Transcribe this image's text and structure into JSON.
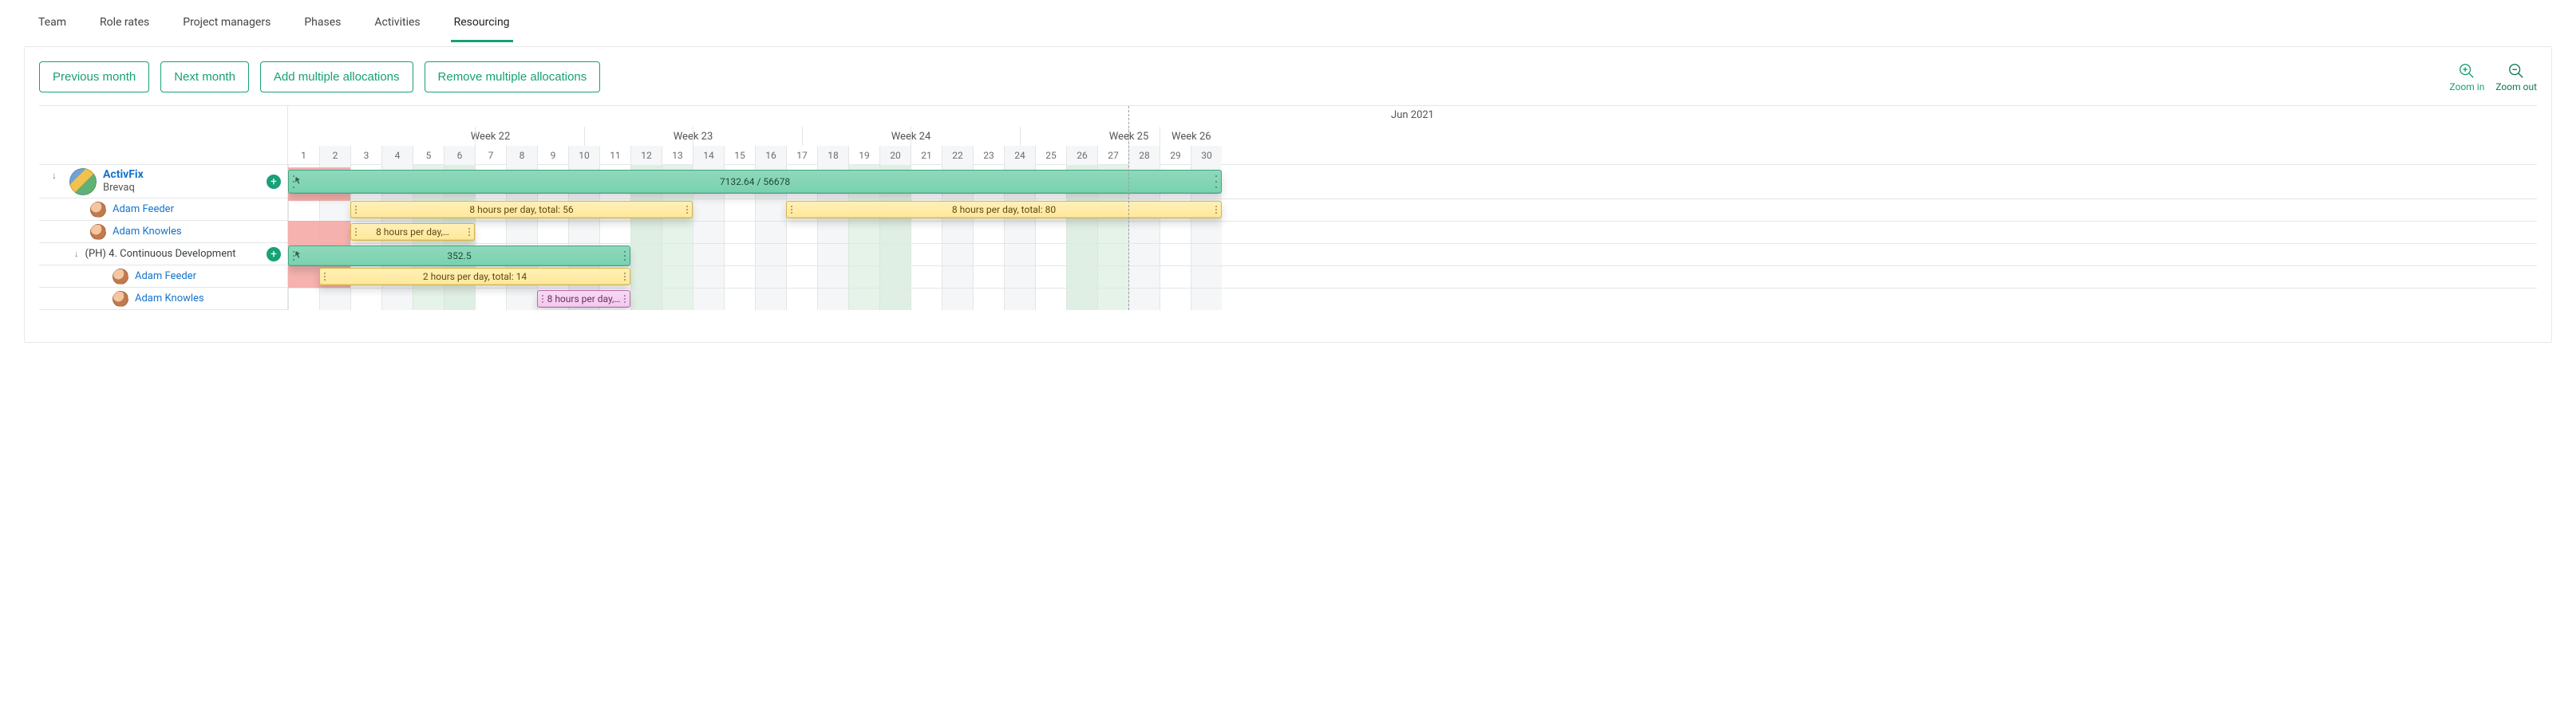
{
  "tabs": [
    {
      "label": "Team",
      "active": false
    },
    {
      "label": "Role rates",
      "active": false
    },
    {
      "label": "Project managers",
      "active": false
    },
    {
      "label": "Phases",
      "active": false
    },
    {
      "label": "Activities",
      "active": false
    },
    {
      "label": "Resourcing",
      "active": true
    }
  ],
  "toolbar": {
    "prev": "Previous month",
    "next": "Next month",
    "add": "Add multiple allocations",
    "remove": "Remove multiple allocations",
    "zoom_in": "Zoom in",
    "zoom_out": "Zoom out"
  },
  "timeline": {
    "month": "Jun 2021",
    "day_start": 1,
    "day_end": 30,
    "weeks": [
      {
        "label": "",
        "start": 1,
        "end": 6
      },
      {
        "label": "Week 22",
        "start": 7,
        "end": 13
      },
      {
        "label": "Week 23",
        "start": 14,
        "end": 20
      },
      {
        "label": "Week 24",
        "start": 21,
        "end": 27
      },
      {
        "label": "Week 25",
        "start": 28,
        "end": 30
      },
      {
        "label": "Week 26",
        "start": 28,
        "end": 30
      }
    ],
    "week_headers": [
      {
        "label": "Week 22",
        "col": 4
      },
      {
        "label": "Week 23",
        "col": 10.5
      },
      {
        "label": "Week 24",
        "col": 17.5
      },
      {
        "label": "Week 25",
        "col": 24.5
      },
      {
        "label": "Week 26",
        "col": 29
      }
    ],
    "week_seps": [
      6,
      13,
      20,
      27
    ],
    "weekends": [
      [
        5,
        6
      ],
      [
        12,
        13
      ],
      [
        19,
        20
      ],
      [
        26,
        27
      ]
    ],
    "marker_day": 28
  },
  "rows": [
    {
      "type": "project",
      "title": "ActivFix",
      "subtitle": "Brevaq",
      "add": true,
      "caret": true
    },
    {
      "type": "user",
      "name": "Adam Feeder"
    },
    {
      "type": "user",
      "name": "Adam Knowles"
    },
    {
      "type": "phase",
      "label": "(PH) 4. Continuous Development",
      "add": true,
      "caret": true
    },
    {
      "type": "user",
      "name": "Adam Feeder",
      "indent": 2
    },
    {
      "type": "user",
      "name": "Adam Knowles",
      "indent": 2
    }
  ],
  "bars": [
    {
      "kind": "red",
      "row": 0,
      "start": 1,
      "end": 2
    },
    {
      "kind": "green",
      "row": 0,
      "start": 1,
      "end": 30,
      "label": "7132.64 / 56678",
      "big": true,
      "point": true
    },
    {
      "kind": "yellow",
      "row": 1,
      "start": 3,
      "end": 13,
      "label": "8 hours per day, total: 56"
    },
    {
      "kind": "yellow",
      "row": 1,
      "start": 17,
      "end": 30,
      "label": "8 hours per day, total: 80"
    },
    {
      "kind": "red",
      "row": 2,
      "start": 1,
      "end": 2
    },
    {
      "kind": "yellow",
      "row": 2,
      "start": 3,
      "end": 6,
      "label": "8 hours per day,…"
    },
    {
      "kind": "red",
      "row": 3,
      "start": 1,
      "end": 2
    },
    {
      "kind": "green",
      "row": 3,
      "start": 1,
      "end": 11,
      "label": "352.5",
      "point": true
    },
    {
      "kind": "red",
      "row": 4,
      "start": 1,
      "end": 2
    },
    {
      "kind": "yellow",
      "row": 4,
      "start": 2,
      "end": 11,
      "label": "2 hours per day, total: 14"
    },
    {
      "kind": "pink",
      "row": 5,
      "start": 9,
      "end": 11,
      "label": "8 hours per day,…"
    }
  ]
}
